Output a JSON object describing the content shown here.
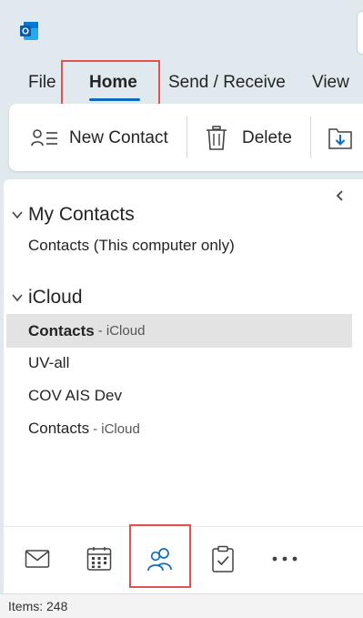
{
  "app": {
    "icon": "outlook-icon",
    "accent": "#0f6cbd"
  },
  "ribbon_tabs": [
    "File",
    "Home",
    "Send / Receive",
    "View"
  ],
  "ribbon_commands": {
    "new_contact": "New Contact",
    "delete": "Delete",
    "move_icon": "move-to-folder-icon"
  },
  "folder_pane": {
    "groups": [
      {
        "title": "My Contacts",
        "folders": [
          {
            "name": "Contacts (This computer only)",
            "suffix": ""
          }
        ]
      },
      {
        "title": "iCloud",
        "folders": [
          {
            "name": "Contacts",
            "suffix": "- iCloud",
            "selected": true
          },
          {
            "name": "UV-all",
            "suffix": ""
          },
          {
            "name": "COV AIS Dev",
            "suffix": ""
          },
          {
            "name": "Contacts",
            "suffix": "- iCloud"
          }
        ]
      }
    ]
  },
  "nav": {
    "items": [
      "mail-icon",
      "calendar-icon",
      "people-icon",
      "tasks-icon",
      "more-icon"
    ],
    "active": "people-icon"
  },
  "status": {
    "items": "Items: 248"
  },
  "highlight_color": "#e35252"
}
